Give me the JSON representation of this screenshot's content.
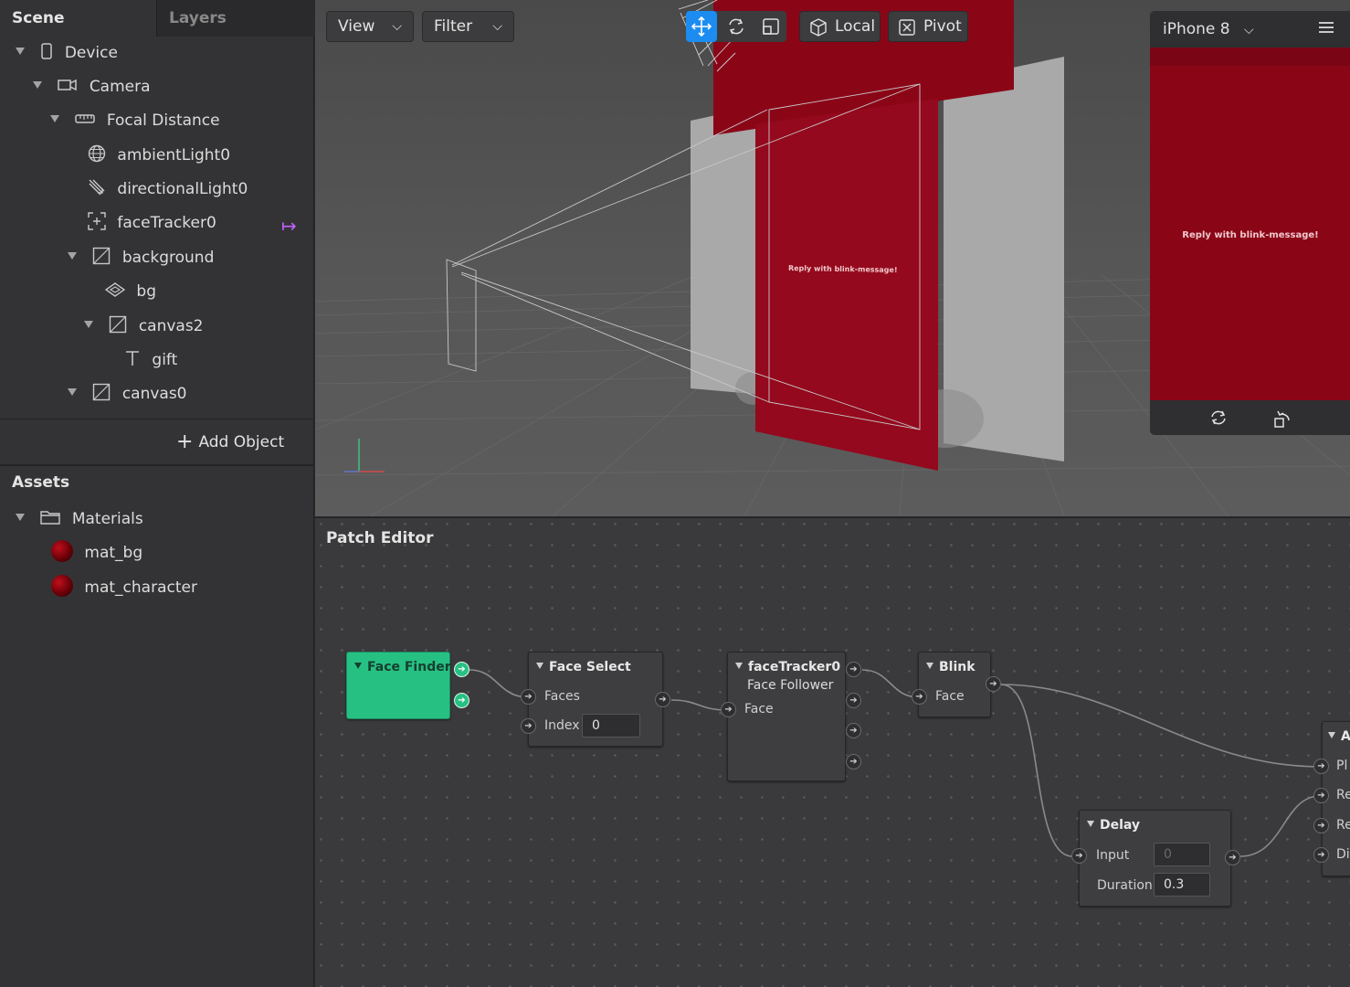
{
  "scene_panel": {
    "tabs": [
      "Scene",
      "Layers"
    ],
    "tree": [
      {
        "label": "Device"
      },
      {
        "label": "Camera"
      },
      {
        "label": "Focal Distance"
      },
      {
        "label": "ambientLight0"
      },
      {
        "label": "directionalLight0"
      },
      {
        "label": "faceTracker0"
      },
      {
        "label": "background"
      },
      {
        "label": "bg"
      },
      {
        "label": "canvas2"
      },
      {
        "label": "gift"
      },
      {
        "label": "canvas0"
      }
    ],
    "tracker_badge": "↦",
    "add_object": "Add Object"
  },
  "assets": {
    "title": "Assets",
    "folder": "Materials",
    "materials": [
      "mat_bg",
      "mat_character"
    ],
    "material_color": "#8a0617"
  },
  "viewport": {
    "view_label": "View",
    "filter_label": "Filter",
    "local_label": "Local",
    "pivot_label": "Pivot",
    "active_tool": "move",
    "canvas_text": "Reply with blink-message!",
    "accent_color": "#1c8cf0"
  },
  "device": {
    "name": "iPhone 8",
    "message": "Reply with blink-message!"
  },
  "patch_editor": {
    "title": "Patch Editor",
    "face_finder": {
      "title": "Face Finder",
      "color": "#27c083"
    },
    "face_select": {
      "title": "Face Select",
      "faces": "Faces",
      "index": "Index",
      "index_value": "0"
    },
    "face_tracker": {
      "title": "faceTracker0",
      "subtitle": "Face Follower",
      "face": "Face"
    },
    "blink": {
      "title": "Blink",
      "face": "Face"
    },
    "delay": {
      "title": "Delay",
      "input": "Input",
      "input_value": "0",
      "duration": "Duration",
      "duration_value": "0.3"
    },
    "partial_node": {
      "title": "A",
      "ports": [
        "Pl",
        "Re",
        "Re",
        "Di"
      ]
    }
  }
}
